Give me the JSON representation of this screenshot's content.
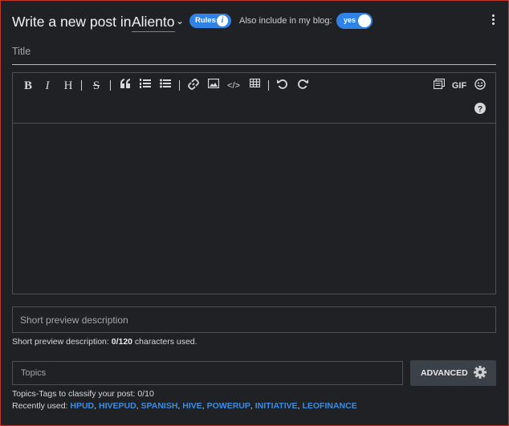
{
  "header": {
    "title_prefix": "Write a new post in",
    "community": "Aliento",
    "rules_label": "Rules",
    "also_include_label": "Also include in my blog:",
    "toggle_label": "yes"
  },
  "title_field": {
    "placeholder": "Title",
    "value": ""
  },
  "toolbar": {
    "bold": "B",
    "italic": "I",
    "heading": "H",
    "strike": "S",
    "gif": "GIF",
    "help": "?"
  },
  "description": {
    "placeholder": "Short preview description",
    "help_prefix": "Short preview description: ",
    "count": "0/120",
    "help_suffix": " characters used."
  },
  "topics": {
    "placeholder": "Topics",
    "help": "Topics-Tags to classify your post: 0/10",
    "recent_label": "Recently used: ",
    "recent": [
      "HPUD",
      "HIVEPUD",
      "SPANISH",
      "HIVE",
      "POWERUP",
      "INITIATIVE",
      "LEOFINANCE"
    ]
  },
  "advanced_button": {
    "label": "ADVANCED"
  },
  "colors": {
    "accent": "#2f83e6",
    "link": "#3a8ee6",
    "background": "#1f2124"
  }
}
